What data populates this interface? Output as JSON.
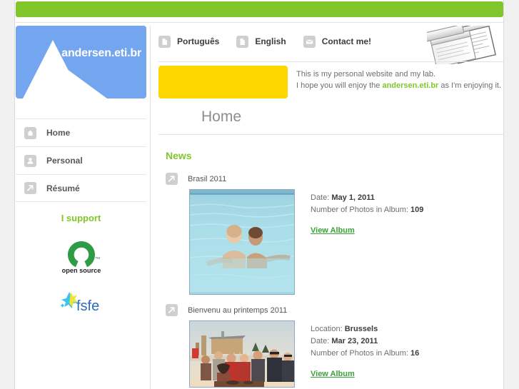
{
  "site": {
    "logo_text": "andersen.eti.br",
    "accent_green": "#80c62a",
    "logo_blue": "#74a5ef",
    "highlight_yellow": "#ffd700",
    "link_green": "#3aa33a"
  },
  "sidebar": {
    "nav": [
      {
        "label": "Home",
        "icon": "home-icon"
      },
      {
        "label": "Personal",
        "icon": "person-icon"
      },
      {
        "label": "Résumé",
        "icon": "arrow-out-icon"
      }
    ],
    "support": {
      "title": "I support",
      "logos": [
        {
          "name": "open-source-initiative-logo",
          "text": "open source"
        },
        {
          "name": "fsfe-logo",
          "text": "fsfe"
        }
      ]
    }
  },
  "header": {
    "links": [
      {
        "label": "Português",
        "icon": "page-icon"
      },
      {
        "label": "English",
        "icon": "page-icon"
      },
      {
        "label": "Contact me!",
        "icon": "envelope-icon"
      }
    ]
  },
  "intro": {
    "line1": "This is my personal website and my lab.",
    "line2_pre": "I hope you will enjoy the ",
    "line2_strong": "andersen.eti.br",
    "line2_post": " as I'm enjoying it."
  },
  "main": {
    "page_title": "Home",
    "news_heading": "News",
    "news": [
      {
        "title": "Brasil 2011",
        "icon": "arrow-out-icon",
        "photo": "pool-photo",
        "fields": [
          {
            "label": "Date:",
            "value": "May 1, 2011"
          },
          {
            "label": "Number of Photos in Album:",
            "value": "109"
          }
        ],
        "link": "View Album"
      },
      {
        "title": "Bienvenu au printemps 2011",
        "icon": "arrow-out-icon",
        "photo": "rooftop-group-photo",
        "fields": [
          {
            "label": "Location:",
            "value": "Brussels"
          },
          {
            "label": "Date:",
            "value": "Mar 23, 2011"
          },
          {
            "label": "Number of Photos in Album:",
            "value": "16"
          }
        ],
        "link": "View Album"
      }
    ]
  }
}
